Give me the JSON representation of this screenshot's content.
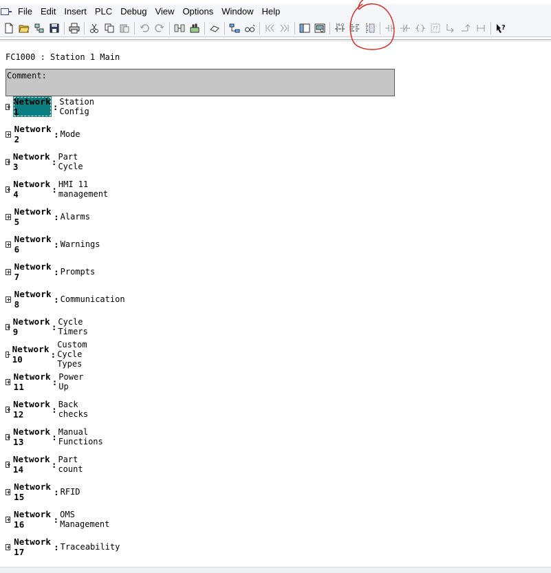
{
  "menu": [
    "File",
    "Edit",
    "Insert",
    "PLC",
    "Debug",
    "View",
    "Options",
    "Window",
    "Help"
  ],
  "block": {
    "title": "FC1000 : Station 1 Main",
    "comment_label": "Comment:"
  },
  "networks": [
    {
      "label": "Network 1",
      "colon": ":",
      "name": "Station Config",
      "selected": true
    },
    {
      "label": "Network 2",
      "colon": ":",
      "name": "Mode"
    },
    {
      "label": "Network 3",
      "colon": ":",
      "name": "Part Cycle"
    },
    {
      "label": "Network 4",
      "colon": ":",
      "name": "HMI 11 management"
    },
    {
      "label": "Network 5",
      "colon": ":",
      "name": "Alarms"
    },
    {
      "label": "Network 6",
      "colon": ":",
      "name": "Warnings"
    },
    {
      "label": "Network 7",
      "colon": ":",
      "name": "Prompts"
    },
    {
      "label": "Network 8",
      "colon": ":",
      "name": "Communication"
    },
    {
      "label": "Network 9",
      "colon": ":",
      "name": "Cycle Timers"
    },
    {
      "label": "Network 10",
      "colon": ":",
      "name": "Custom Cycle Types"
    },
    {
      "label": "Network 11",
      "colon": ":",
      "name": "Power Up"
    },
    {
      "label": "Network 12",
      "colon": ":",
      "name": "Back checks"
    },
    {
      "label": "Network 13",
      "colon": ":",
      "name": "Manual Functions"
    },
    {
      "label": "Network 14",
      "colon": ":",
      "name": "Part count"
    },
    {
      "label": "Network 15",
      "colon": ":",
      "name": "RFID"
    },
    {
      "label": "Network 16",
      "colon": ":",
      "name": "OMS Management"
    },
    {
      "label": "Network 17",
      "colon": ":",
      "name": "Traceability"
    }
  ],
  "colors": {
    "selection": "#0e7f80",
    "comment_bg": "#c6c6c6",
    "annotation": "#e0201a"
  }
}
